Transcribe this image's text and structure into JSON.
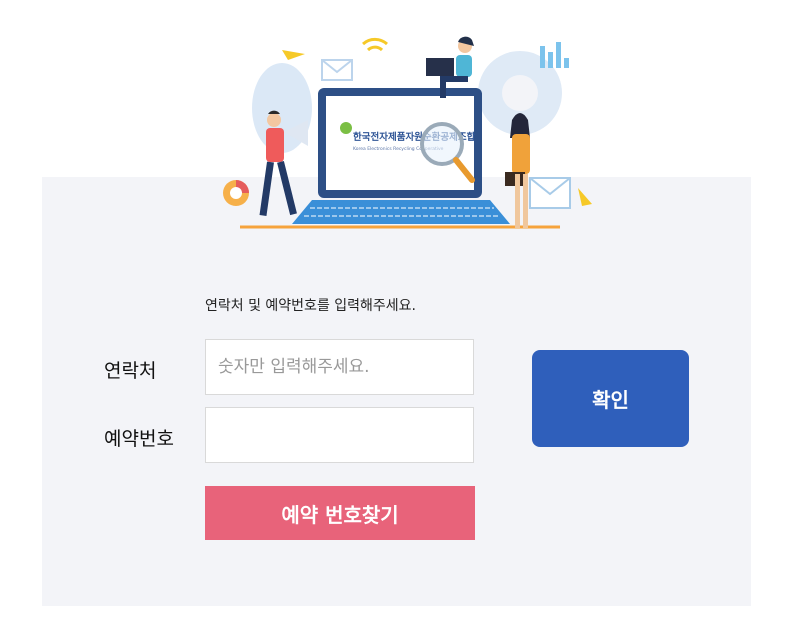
{
  "hero": {
    "logo_text": "한국전자제품자원순환공제조합",
    "logo_subtext": "Korea Electronics Recycling Cooperative"
  },
  "form": {
    "instruction": "연락처 및 예약번호를 입력해주세요.",
    "phone_label": "연락처",
    "phone_placeholder": "숫자만 입력해주세요.",
    "phone_value": "",
    "reservation_label": "예약번호",
    "reservation_value": "",
    "confirm_label": "확인",
    "find_label": "예약 번호찾기"
  },
  "colors": {
    "confirm_button": "#2f5fbb",
    "find_button": "#e8637a",
    "panel_background": "#f3f4f8"
  }
}
